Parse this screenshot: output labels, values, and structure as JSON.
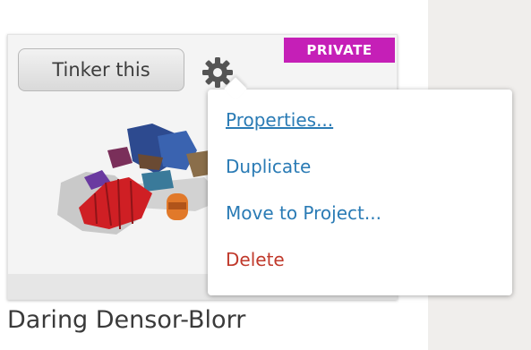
{
  "card": {
    "tinker_label": "Tinker this",
    "badge": "PRIVATE",
    "title": "Daring Densor-Blorr"
  },
  "menu": {
    "items": [
      {
        "label": "Properties...",
        "color": "#2a7bb5"
      },
      {
        "label": "Duplicate",
        "color": "#2a7bb5"
      },
      {
        "label": "Move to Project...",
        "color": "#2a7bb5"
      },
      {
        "label": "Delete",
        "color": "#c0392b"
      }
    ]
  },
  "icons": {
    "gear": "gear-icon"
  },
  "colors": {
    "badge": "#c51fb7",
    "link": "#2a7bb5",
    "danger": "#c0392b",
    "side_panel": "#f0eeec"
  }
}
